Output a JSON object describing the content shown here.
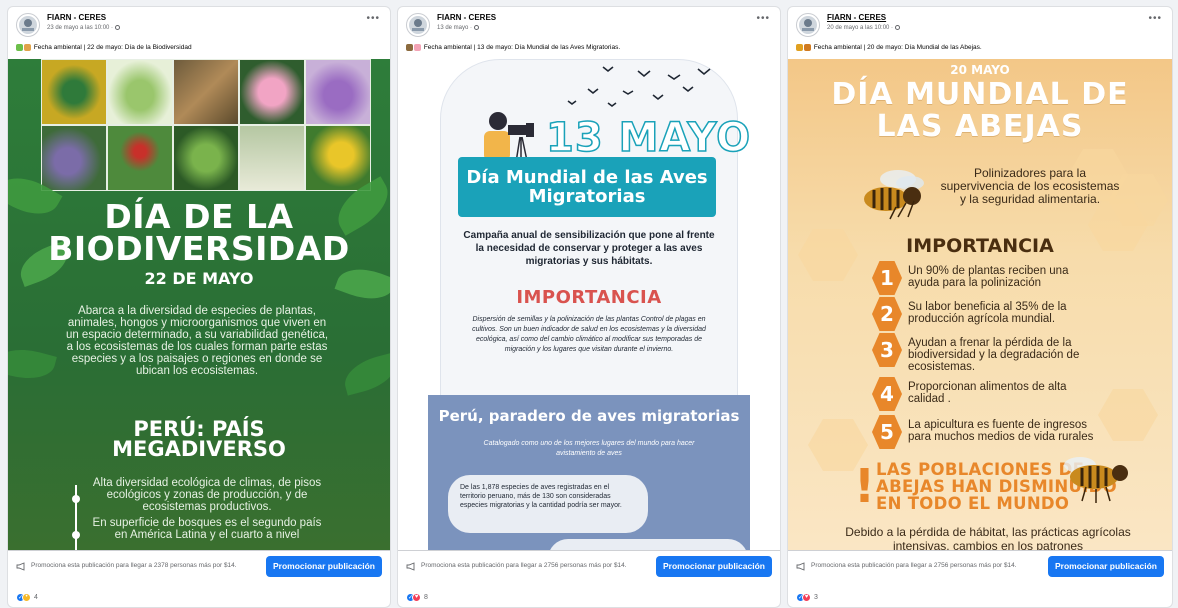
{
  "posts": [
    {
      "page_name": "FIARN - CERES",
      "time": "23 de mayo a las 10:00 ·",
      "caption": "Fecha ambiental | 22 de mayo: Día de la Biodiversidad",
      "image": {
        "title_line1": "DÍA DE LA",
        "title_line2": "BIODIVERSIDAD",
        "date": "22 DE MAYO",
        "body": "Abarca a la diversidad de especies de plantas, animales, hongos y microorganismos que viven en un espacio determinado, a su variabilidad genética, a los ecosistemas de los cuales forman parte estas especies y a los paisajes o regiones en donde se ubican los ecosistemas.",
        "subtitle_line1": "PERÚ: PAÍS",
        "subtitle_line2": "MEGADIVERSO",
        "point1": "Alta diversidad ecológica de climas, de pisos ecológicos y zonas de producción, y de ecosistemas productivos.",
        "point2": "En superficie de bosques es el segundo país en América Latina y el cuarto a nivel"
      },
      "promo_text": "Promociona esta publicación para llegar a 2378 personas más por $14.",
      "promo_button": "Promocionar publicación",
      "reaction_count": "4"
    },
    {
      "page_name": "FIARN - CERES",
      "time": "13 de mayo ·",
      "caption": "Fecha ambiental | 13 de mayo: Día Mundial de las Aves Migratorias.",
      "image": {
        "date": "13 MAYO",
        "banner_line1": "Día Mundial de las Aves",
        "banner_line2": "Migratorias",
        "lead": "Campaña anual de sensibilización que pone al frente la necesidad de conservar y proteger a las aves migratorias y sus hábitats.",
        "importance": "IMPORTANCIA",
        "importance_text": "Dispersión de semillas y la polinización de las plantas Control de plagas en cultivos. Son un buen indicador de salud en los ecosistemas y la diversidad ecológica, así como del cambio climático al modificar sus temporadas de migración y los lugares que visitan durante el invierno.",
        "peru_title": "Perú, paradero de aves migratorias",
        "peru_sub": "Catalogado como uno de los mejores lugares del mundo para hacer avistamiento de aves",
        "bubble": "De las 1,878 especies de aves registradas en el territorio peruano, más de 130 son consideradas especies migratorias y la cantidad podría ser mayor."
      },
      "promo_text": "Promociona esta publicación para llegar a 2756 personas más por $14.",
      "promo_button": "Promocionar publicación",
      "reaction_count": "8"
    },
    {
      "page_name": "FIARN - CERES",
      "time": "20 de mayo a las 10:00 ·",
      "caption": "Fecha ambiental | 20 de mayo: Día Mundial de las Abejas.",
      "image": {
        "may": "20 MAYO",
        "title_line1": "DÍA MUNDIAL DE",
        "title_line2": "LAS ABEJAS",
        "pollinators": "Polinizadores para la supervivencia de los ecosistemas y la seguridad alimentaria.",
        "importance": "IMPORTANCIA",
        "items": [
          {
            "n": "1",
            "text": "Un 90% de plantas reciben una ayuda para la polinización"
          },
          {
            "n": "2",
            "text": "Su labor beneficia al 35% de la producción agrícola mundial."
          },
          {
            "n": "3",
            "text": "Ayudan a frenar la pérdida de la biodiversidad y la degradación de ecosistemas."
          },
          {
            "n": "4",
            "text": "Proporcionan alimentos de alta calidad ."
          },
          {
            "n": "5",
            "text": "La apicultura es fuente de ingresos para muchos medios de vida rurales"
          }
        ],
        "warning_mark": "!",
        "warning_line1": "LAS POBLACIONES DE",
        "warning_line2": "ABEJAS HAN DISMINUIDO",
        "warning_line3": "EN TODO EL MUNDO",
        "tail": "Debido a la pérdida de hábitat, las prácticas agrícolas intensivas, cambios en los patrones"
      },
      "promo_text": "Promociona esta publicación para llegar a 2756 personas más por $14.",
      "promo_button": "Promocionar publicación",
      "reaction_count": "3"
    }
  ],
  "colors": {
    "promo_button": "#1877f2",
    "bio_green": "#2e7d3a",
    "birds_teal": "#1aa2b9",
    "birds_blue": "#7b93bd",
    "bees_orange": "#e8872a"
  },
  "icons": {
    "avatar": "ceres-logo-icon",
    "more": "more-dots-icon",
    "privacy": "globe-icon",
    "promo": "megaphone-icon",
    "reactions": [
      "like-icon",
      "care-icon",
      "love-icon"
    ]
  }
}
